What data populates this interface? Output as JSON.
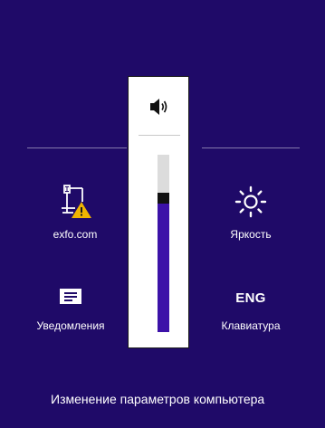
{
  "volume": {
    "icon": "speaker-icon",
    "level_percent": 73
  },
  "tiles": {
    "network": {
      "label": "exfo.com",
      "icon": "network-warning-icon"
    },
    "brightness": {
      "label": "Яркость",
      "icon": "brightness-sun-icon"
    },
    "notifications": {
      "label": "Уведомления",
      "icon": "notifications-icon"
    },
    "keyboard": {
      "layout": "ENG",
      "label": "Клавиатура"
    }
  },
  "footer": {
    "link_label": "Изменение параметров компьютера"
  },
  "colors": {
    "background": "#1f0a68",
    "volume_fill": "#3c12a8",
    "warning": "#f0b400"
  }
}
